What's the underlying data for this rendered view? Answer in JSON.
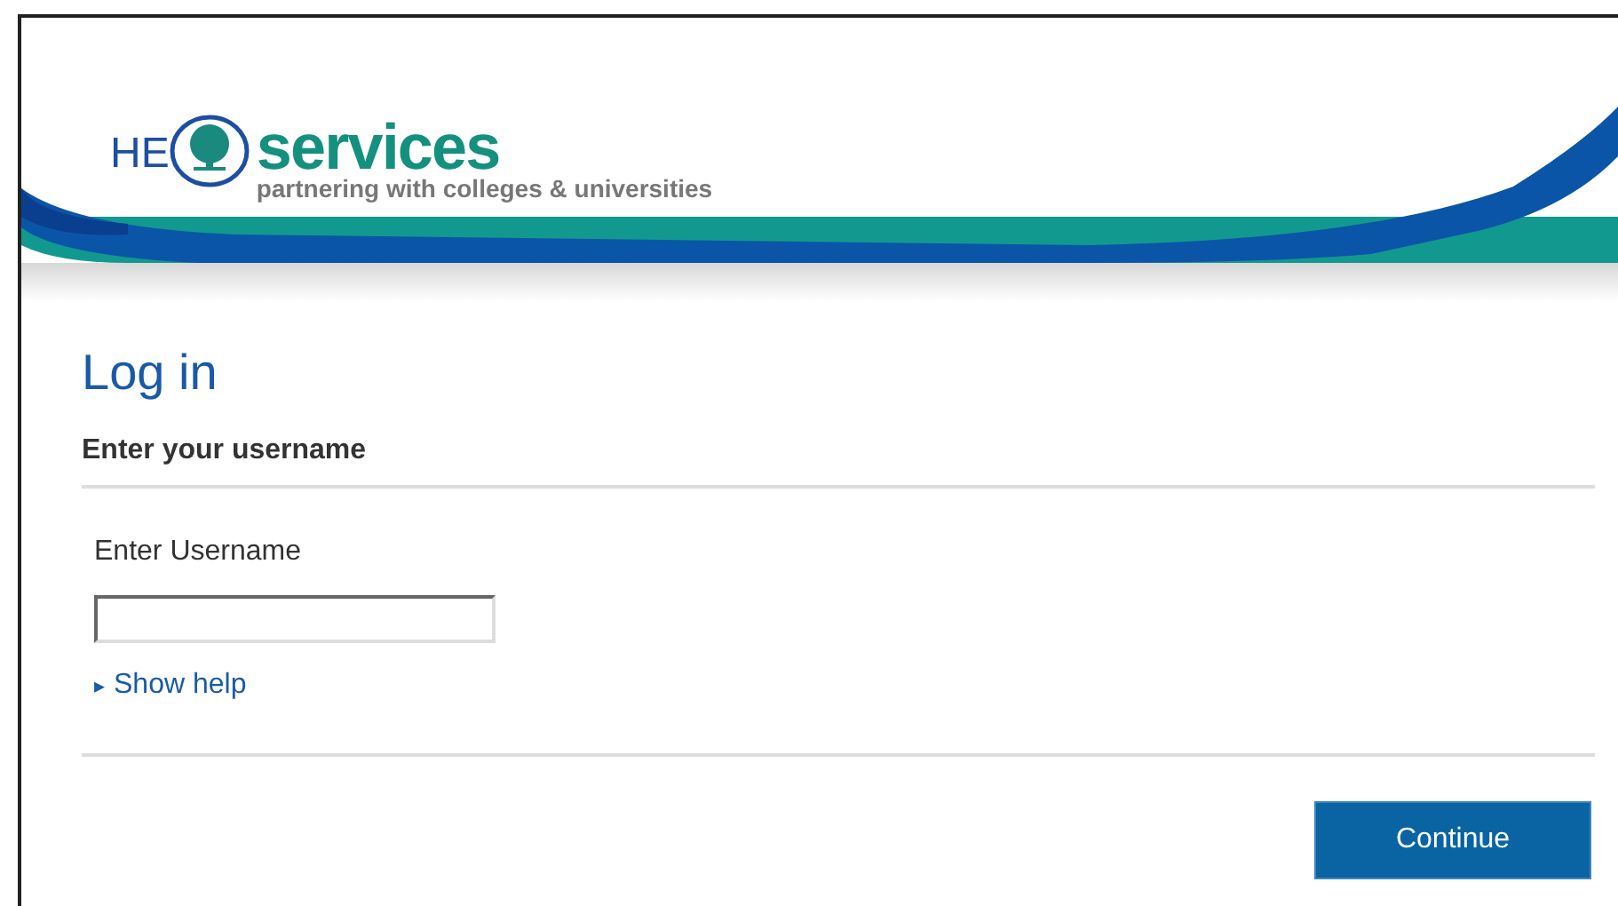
{
  "logo": {
    "prefix": "HE",
    "name": "services",
    "tagline": "partnering with colleges & universities"
  },
  "heading": "Log in",
  "section_title": "Enter your username",
  "username_field": {
    "label": "Enter Username"
  },
  "help_link": {
    "marker": "▸",
    "label": "Show help"
  },
  "continue_button": "Continue"
}
